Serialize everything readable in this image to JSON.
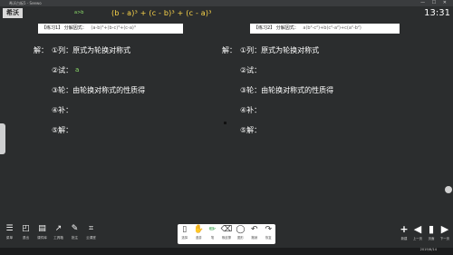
{
  "window": {
    "title": "希沃白板5 - Seewo",
    "controls": "— ☐ ✕"
  },
  "logo": "希沃",
  "clock": "13:31",
  "handwriting": {
    "green": "a>b",
    "yellow": "(b - a)³ + (c - b)³ + (c - a)³"
  },
  "exercise1": {
    "label": "【练习1】",
    "text": "分解因式：",
    "formula": "(a-b)³+(b-c)³+(c-a)³"
  },
  "exercise2": {
    "label": "【练习2】",
    "text": "分解因式：",
    "formula": "a(b²-c²)+b(c²-a²)+c(a²-b²)"
  },
  "left_steps": [
    {
      "lead": "解：",
      "text": "①列：原式为轮换对称式"
    },
    {
      "lead": "",
      "text": "②试：",
      "mark": "a"
    },
    {
      "lead": "",
      "text": "③轮：由轮换对称式的性质得"
    },
    {
      "lead": "",
      "text": "④补："
    },
    {
      "lead": "",
      "text": "⑤解："
    }
  ],
  "right_steps": [
    {
      "lead": "解：",
      "text": "①列：原式为轮换对称式"
    },
    {
      "lead": "",
      "text": "②试："
    },
    {
      "lead": "",
      "text": "③轮：由轮换对称式的性质得"
    },
    {
      "lead": "",
      "text": "④补："
    },
    {
      "lead": "",
      "text": "⑤解："
    }
  ],
  "toolbar_left": [
    {
      "icon": "☰",
      "label": "菜单"
    },
    {
      "icon": "◰",
      "label": "退出"
    },
    {
      "icon": "▤",
      "label": "课件库"
    },
    {
      "icon": "↗",
      "label": "工具箱"
    },
    {
      "icon": "✎",
      "label": "批注"
    },
    {
      "icon": "⌗",
      "label": "云课堂"
    }
  ],
  "toolbar_center": [
    {
      "icon": "▯",
      "label": "选择"
    },
    {
      "icon": "✋",
      "label": "漫游"
    },
    {
      "icon": "✏",
      "label": "笔"
    },
    {
      "icon": "⌫",
      "label": "橡皮擦"
    },
    {
      "icon": "◯",
      "label": "图形"
    },
    {
      "icon": "↶",
      "label": "撤销"
    },
    {
      "icon": "↷",
      "label": "恢复"
    }
  ],
  "toolbar_right": [
    {
      "icon": "+",
      "label": "新建"
    },
    {
      "icon": "◀",
      "label": "上一页"
    },
    {
      "icon": "▮",
      "label": "页面"
    },
    {
      "icon": "▶",
      "label": "下一页"
    }
  ],
  "taskbar_time": "2019/6/14"
}
